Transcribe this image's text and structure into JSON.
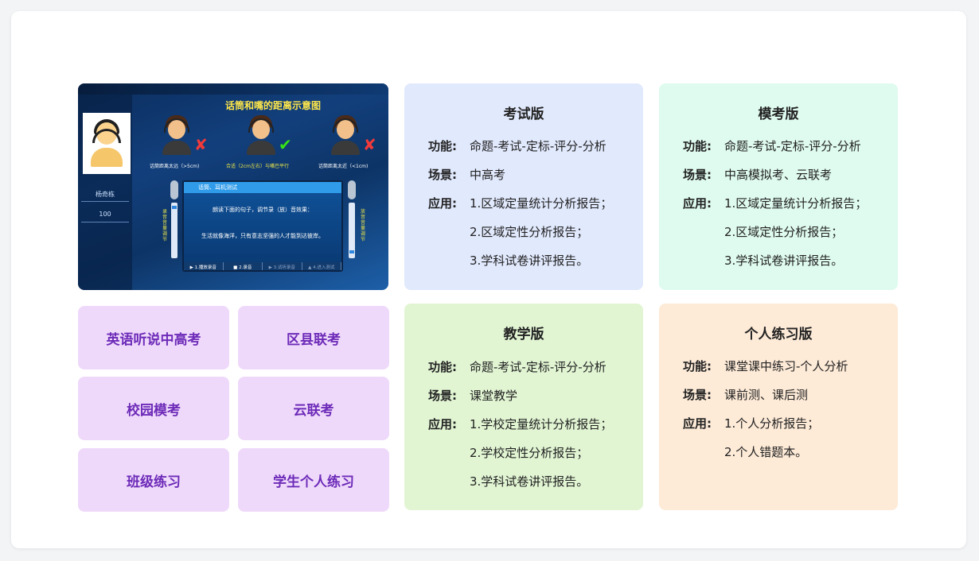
{
  "screenshot": {
    "title": "话筒和嘴的距离示意图",
    "student_name": "杨奇栋",
    "score": "100",
    "faces": [
      {
        "caption": "话筒距离太远（>5cm)",
        "result": "cross"
      },
      {
        "caption": "合适（2cm左右）与嘴巴平行",
        "result": "tick"
      },
      {
        "caption": "话筒距离太近（<1cm)",
        "result": "cross"
      }
    ],
    "left_volume_label": "录音音量调节",
    "right_volume_label": "放音音量调节",
    "dialog": {
      "title": "话筒、耳机测试",
      "instruction": "朗读下面的句子，调节录（放）音效果：",
      "sentence": "生活就像海洋，只有意志坚强的人才能到达彼岸。",
      "buttons": [
        "▶ 1.播放录音",
        "■ 2.录音",
        "▶ 3.试听录音",
        "▲ 4.进入测试"
      ]
    },
    "colors": {
      "title": "#ffe74a",
      "ok": "#37e317",
      "bad": "#f23a3a"
    }
  },
  "tiles": [
    "英语听说中高考",
    "区县联考",
    "校园模考",
    "云联考",
    "班级练习",
    "学生个人练习"
  ],
  "cards": [
    {
      "title": "考试版",
      "function_label": "功能:",
      "function": "命题-考试-定标-评分-分析",
      "scene_label": "场景:",
      "scene": "中高考",
      "apply_label": "应用:",
      "apply": [
        "1.区域定量统计分析报告；",
        "2.区域定性分析报告；",
        "3.学科试卷讲评报告。"
      ],
      "color": "#e1e9fd"
    },
    {
      "title": "模考版",
      "function_label": "功能:",
      "function": "命题-考试-定标-评分-分析",
      "scene_label": "场景:",
      "scene": "中高模拟考、云联考",
      "apply_label": "应用:",
      "apply": [
        "1.区域定量统计分析报告；",
        "2.区域定性分析报告；",
        "3.学科试卷讲评报告。"
      ],
      "color": "#dffbef"
    },
    {
      "title": "教学版",
      "function_label": "功能:",
      "function": "命题-考试-定标-评分-分析",
      "scene_label": "场景:",
      "scene": "课堂教学",
      "apply_label": "应用:",
      "apply": [
        "1.学校定量统计分析报告；",
        "2.学校定性分析报告；",
        "3.学科试卷讲评报告。"
      ],
      "color": "#e1f5d3"
    },
    {
      "title": "个人练习版",
      "function_label": "功能:",
      "function": "课堂课中练习-个人分析",
      "scene_label": "场景:",
      "scene": "课前测、课后测",
      "apply_label": "应用:",
      "apply": [
        "1.个人分析报告；",
        "2.个人错题本。"
      ],
      "color": "#fdead7"
    }
  ]
}
